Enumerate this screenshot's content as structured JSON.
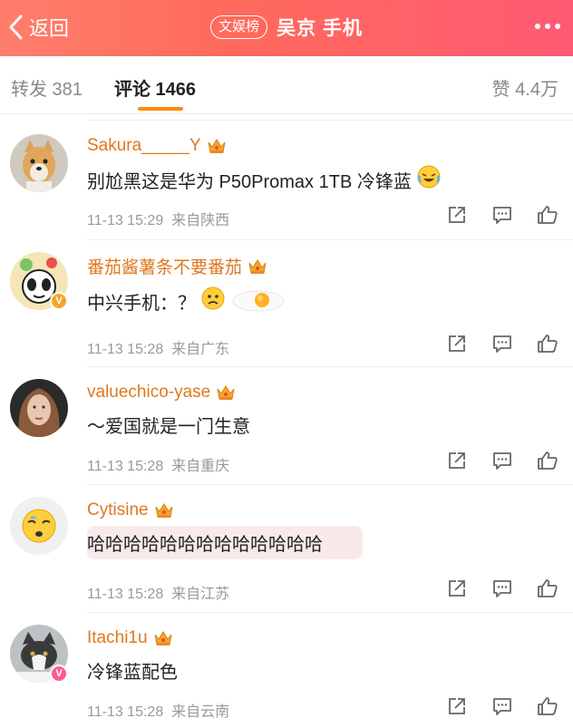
{
  "header": {
    "back_label": "返回",
    "badge": "文娱榜",
    "title": "吴京 手机"
  },
  "tabs": {
    "repost": "转发 381",
    "comment": "评论 1466",
    "like": "赞 4.4万"
  },
  "comments": [
    {
      "user": "Sakura_____Y",
      "text": "别尬黑这是华为 P50Promax 1TB 冷锋蓝",
      "time": "11-13 15:29",
      "location": "来自陕西"
    },
    {
      "user": "番茄酱薯条不要番茄",
      "text": "中兴手机：？",
      "time": "11-13 15:28",
      "location": "来自广东"
    },
    {
      "user": "valuechico-yase",
      "text": "～爱国就是一门生意",
      "time": "11-13 15:28",
      "location": "来自重庆"
    },
    {
      "user": "Cytisine",
      "text": "哈哈哈哈哈哈哈哈哈哈哈哈哈",
      "time": "11-13 15:28",
      "location": "来自江苏"
    },
    {
      "user": "Itachi1u",
      "text": "冷锋蓝配色",
      "time": "11-13 15:28",
      "location": "来自云南"
    }
  ],
  "colors": {
    "header_start": "#ff7e6b",
    "header_end": "#ff5a73",
    "username": "#e0771f",
    "tab_underline": "#ff8a00"
  }
}
